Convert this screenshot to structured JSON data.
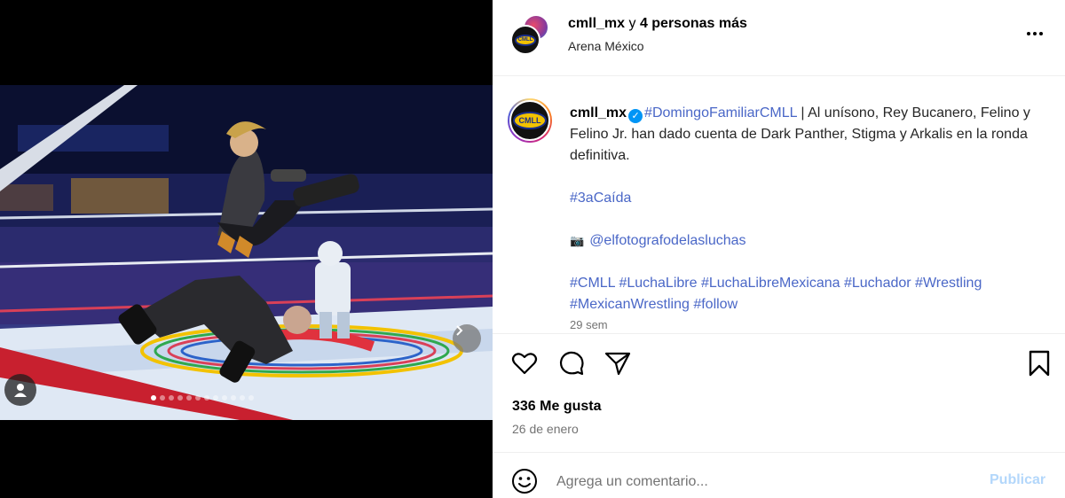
{
  "post": {
    "carousel": {
      "dot_count": 12,
      "active_index": 0
    }
  },
  "header": {
    "username": "cmll_mx",
    "connector": " y ",
    "collaborators": "4 personas más",
    "location": "Arena México",
    "avatar_logo_text": "CMLL"
  },
  "caption": {
    "username": "cmll_mx",
    "verified": true,
    "hashtag_main": "#DomingoFamiliarCMLL",
    "body": " | Al unísono, Rey Bucanero, Felino y Felino Jr. han dado cuenta de Dark Panther, Stigma y Arkalis en la ronda definitiva.",
    "hashtag_fall": "#3aCaída",
    "camera_emoji": "📷",
    "photographer": "@elfotografodelasluchas",
    "tags": [
      "#CMLL",
      "#LuchaLibre",
      "#LuchaLibreMexicana",
      "#Luchador",
      "#Wrestling",
      "#MexicanWrestling",
      "#follow"
    ],
    "time_ago": "29 sem"
  },
  "engagement": {
    "likes": "336 Me gusta",
    "date": "26 de enero"
  },
  "comment": {
    "placeholder": "Agrega un comentario...",
    "publish_label": "Publicar"
  },
  "colors": {
    "link": "#4a67c7",
    "verified": "#0095f6",
    "publish_disabled": "#b3d7fb",
    "muted": "#737373"
  }
}
